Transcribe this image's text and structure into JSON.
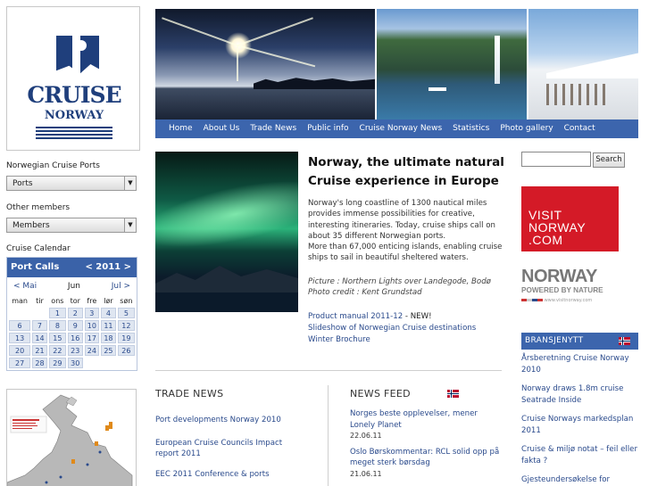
{
  "logo": {
    "word1": "CRUISE",
    "word2": "NORWAY"
  },
  "sidebar": {
    "ports_label": "Norwegian Cruise Ports",
    "ports_select": "Ports",
    "members_label": "Other members",
    "members_select": "Members",
    "calendar_label": "Cruise Calendar"
  },
  "calendar": {
    "title": "Port Calls",
    "year": "< 2011 >",
    "prev": "< Mai",
    "current": "Jun",
    "next": "Jul >",
    "weekdays": [
      "man",
      "tir",
      "ons",
      "tor",
      "fre",
      "lør",
      "søn"
    ],
    "weeks": [
      [
        "",
        "",
        "1",
        "2",
        "3",
        "4",
        "5"
      ],
      [
        "6",
        "7",
        "8",
        "9",
        "10",
        "11",
        "12"
      ],
      [
        "13",
        "14",
        "15",
        "16",
        "17",
        "18",
        "19"
      ],
      [
        "20",
        "21",
        "22",
        "23",
        "24",
        "25",
        "26"
      ],
      [
        "27",
        "28",
        "29",
        "30",
        "",
        "",
        ""
      ]
    ]
  },
  "nav": [
    "Home",
    "About Us",
    "Trade News",
    "Public info",
    "Cruise Norway News",
    "Statistics",
    "Photo gallery",
    "Contact"
  ],
  "main": {
    "headline": "Norway, the ultimate natural Cruise experience in Europe",
    "intro1": "Norway's long coastline of 1300 nautical miles provides immense possibilities for creative, interesting itineraries. Today, cruise ships call on about 35 different Norwegian ports.",
    "intro2": "More than 67,000 enticing islands, enabling cruise ships to sail in beautiful sheltered waters.",
    "caption1": "Picture : Northern Lights over Landegode, Bodø",
    "caption2": "Photo credit : Kent Grundstad",
    "link1": "Product manual 2011-12",
    "link1_suffix": " - NEW!",
    "link2": "Slideshow of Norwegian Cruise destinations",
    "link3": "Winter Brochure"
  },
  "trade_news": {
    "heading": "TRADE NEWS",
    "items": [
      "Port developments Norway 2010",
      "European Cruise Councils Impact report 2011",
      "EEC 2011 Conference & ports"
    ]
  },
  "news_feed": {
    "heading": "NEWS FEED",
    "items": [
      {
        "title": "Norges beste opplevelser, mener Lonely Planet",
        "date": "22.06.11"
      },
      {
        "title": "Oslo Børskommentar: RCL solid opp på meget sterk børsdag",
        "date": "21.06.11"
      }
    ]
  },
  "right": {
    "search_button": "Search",
    "visit_line1": "VISIT",
    "visit_line2": "NORWAY",
    "visit_line3": ".COM",
    "nbn_line1": "NORWAY",
    "nbn_line2": "POWERED BY NATURE",
    "nbn_url": "www.visitnorway.com",
    "bransjenytt": "BRANSJENYTT",
    "items": [
      "Årsberetning Cruise Norway 2010",
      "Norway draws 1.8m cruise Seatrade Inside",
      "Cruise Norways markedsplan 2011",
      "Cruise & miljø notat – feil eller fakta ?",
      "Gjesteundersøkelse for"
    ]
  },
  "colors": {
    "accent": "#3c65ad",
    "link": "#2a4a8c",
    "visit_red": "#d41a27"
  }
}
